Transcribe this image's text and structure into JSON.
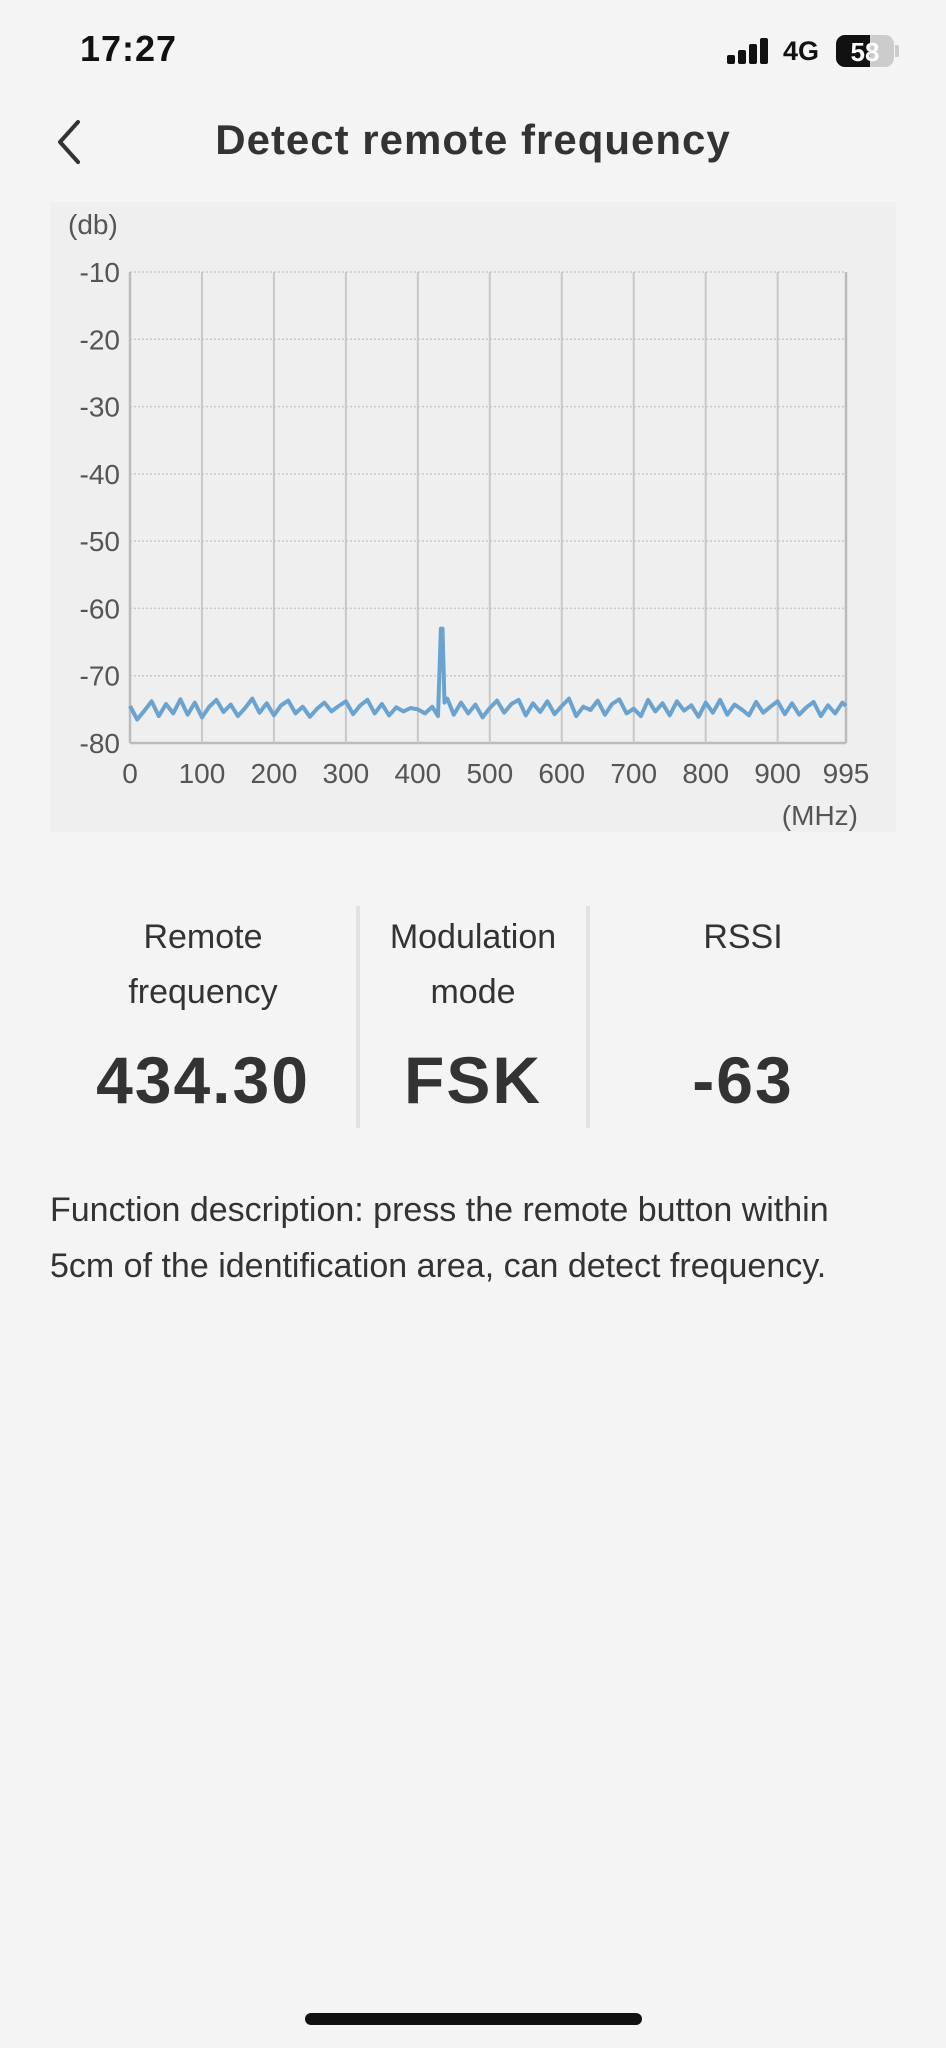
{
  "status_bar": {
    "time": "17:27",
    "network": "4G",
    "battery": "58",
    "battery_level": 0.58
  },
  "header": {
    "title": "Detect remote frequency",
    "back_icon": "chevron-left-icon"
  },
  "chart_data": {
    "type": "line",
    "ylabel": "(db)",
    "xlabel": "(MHz)",
    "ylim": [
      -80,
      -10
    ],
    "xlim": [
      0,
      995
    ],
    "y_ticks": [
      "-10",
      "-20",
      "-30",
      "-40",
      "-50",
      "-60",
      "-70",
      "-80"
    ],
    "x_ticks": [
      "0",
      "100",
      "200",
      "300",
      "400",
      "500",
      "600",
      "700",
      "800",
      "900",
      "995"
    ],
    "grid": true,
    "line_color": "#6aa3d0",
    "series": [
      {
        "x": [
          0,
          10,
          20,
          30,
          40,
          50,
          60,
          70,
          80,
          90,
          100,
          110,
          120,
          130,
          140,
          150,
          160,
          170,
          180,
          190,
          200,
          210,
          220,
          230,
          240,
          250,
          260,
          270,
          280,
          290,
          300,
          310,
          320,
          330,
          340,
          350,
          360,
          370,
          380,
          390,
          400,
          410,
          420,
          428,
          432,
          434.3,
          437,
          441,
          450,
          460,
          470,
          480,
          490,
          500,
          510,
          520,
          530,
          540,
          550,
          560,
          570,
          580,
          590,
          600,
          610,
          620,
          630,
          640,
          650,
          660,
          670,
          680,
          690,
          700,
          710,
          720,
          730,
          740,
          750,
          760,
          770,
          780,
          790,
          800,
          810,
          820,
          830,
          840,
          850,
          860,
          870,
          880,
          890,
          900,
          910,
          920,
          930,
          940,
          950,
          960,
          970,
          980,
          990,
          995
        ],
        "y": [
          -74.5,
          -76.5,
          -75.2,
          -73.8,
          -76.0,
          -74.2,
          -75.6,
          -73.5,
          -75.8,
          -74.0,
          -76.2,
          -74.6,
          -73.6,
          -75.4,
          -74.3,
          -76.0,
          -74.8,
          -73.4,
          -75.5,
          -74.1,
          -75.9,
          -74.4,
          -73.7,
          -75.6,
          -74.6,
          -76.1,
          -74.9,
          -74.0,
          -75.3,
          -74.5,
          -73.8,
          -75.7,
          -74.4,
          -73.6,
          -75.6,
          -74.2,
          -75.9,
          -74.7,
          -75.3,
          -74.8,
          -75.0,
          -75.6,
          -74.6,
          -76.0,
          -63.0,
          -63.0,
          -74.0,
          -73.4,
          -75.8,
          -74.0,
          -75.6,
          -74.3,
          -76.2,
          -74.8,
          -73.7,
          -75.5,
          -74.2,
          -73.6,
          -75.9,
          -74.1,
          -75.4,
          -73.8,
          -75.7,
          -74.5,
          -73.4,
          -76.0,
          -74.6,
          -75.1,
          -73.7,
          -75.8,
          -74.2,
          -73.5,
          -75.6,
          -74.9,
          -76.0,
          -73.6,
          -75.3,
          -74.1,
          -75.9,
          -73.8,
          -75.2,
          -74.4,
          -76.1,
          -74.0,
          -75.5,
          -73.6,
          -75.8,
          -74.3,
          -75.0,
          -75.9,
          -73.9,
          -75.5,
          -74.6,
          -73.8,
          -75.7,
          -74.1,
          -75.8,
          -74.7,
          -73.9,
          -76.0,
          -74.4,
          -75.6,
          -74.0,
          -74.5
        ]
      }
    ]
  },
  "stats": [
    {
      "label_line1": "Remote",
      "label_line2": "frequency",
      "value": "434.30"
    },
    {
      "label_line1": "Modulation",
      "label_line2": "mode",
      "value": "FSK"
    },
    {
      "label_line1": "RSSI",
      "label_line2": "",
      "value": "-63"
    }
  ],
  "description": "Function description: press the remote button within 5cm of the identification area, can detect frequency."
}
